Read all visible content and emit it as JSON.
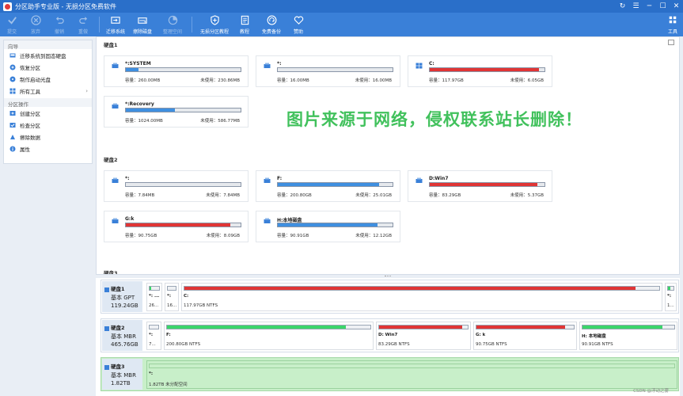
{
  "window": {
    "title": "分区助手专业版 - 无损分区免费软件",
    "controls": [
      "↻",
      "☰",
      "─",
      "☐",
      "✕"
    ]
  },
  "colors": {
    "titlebar": "#2a6fc9",
    "toolbar": "#3a80d8",
    "bar_blue": "#3f8fe0",
    "bar_red": "#e03535",
    "bar_green": "#3bd56a",
    "unallocated": "#c8efc9",
    "watermark": "#41c15c"
  },
  "toolbar": {
    "items": [
      {
        "label": "提交",
        "icon": "check-icon",
        "enabled": false
      },
      {
        "label": "放弃",
        "icon": "cancel-icon",
        "enabled": false
      },
      {
        "label": "撤销",
        "icon": "undo-icon",
        "enabled": false
      },
      {
        "label": "重做",
        "icon": "redo-icon",
        "enabled": false
      },
      {
        "label": "迁移系统",
        "icon": "migrate-os-icon",
        "enabled": true
      },
      {
        "label": "擦除磁盘",
        "icon": "wipe-disk-icon",
        "enabled": true
      },
      {
        "label": "整理空间",
        "icon": "allocate-space-icon",
        "enabled": false
      },
      {
        "label": "无损分区教程",
        "icon": "shield-icon",
        "enabled": true
      },
      {
        "label": "教程",
        "icon": "book-icon",
        "enabled": true
      },
      {
        "label": "免费备份",
        "icon": "backup-icon",
        "enabled": true
      },
      {
        "label": "赞助",
        "icon": "heart-icon",
        "enabled": true
      }
    ],
    "tools_label": "工具"
  },
  "sidebar": {
    "wizard_header": "向导",
    "wizard_items": [
      {
        "label": "迁移系统到固态硬盘",
        "icon": "migrate-icon"
      },
      {
        "label": "恢复分区",
        "icon": "recover-icon"
      },
      {
        "label": "制作启动光盘",
        "icon": "boot-disc-icon"
      },
      {
        "label": "所有工具",
        "icon": "tools-icon",
        "arrow": "›"
      }
    ],
    "ops_header": "分区操作",
    "ops_items": [
      {
        "label": "创建分区",
        "icon": "create-icon"
      },
      {
        "label": "检查分区",
        "icon": "check-partition-icon"
      },
      {
        "label": "擦除数据",
        "icon": "wipe-data-icon"
      },
      {
        "label": "属性",
        "icon": "info-icon"
      }
    ]
  },
  "main": {
    "disk1_title": "硬盘1",
    "disk2_title": "硬盘2",
    "disk3_title": "硬盘3",
    "cap_prefix": "容量：",
    "free_prefix": "未使用：",
    "disk1_cards": [
      {
        "name": "*:SYSTEM",
        "capacity": "260.00MB",
        "free": "230.86MB",
        "used_fraction": 0.11,
        "color": "blue",
        "icon": "drive-icon"
      },
      {
        "name": "*:",
        "capacity": "16.00MB",
        "free": "16.00MB",
        "used_fraction": 0.0,
        "color": "blue",
        "icon": "drive-icon"
      },
      {
        "name": "C:",
        "capacity": "117.97GB",
        "free": "6.05GB",
        "used_fraction": 0.95,
        "color": "red",
        "icon": "windows-icon"
      },
      {
        "name": "*:Recovery",
        "capacity": "1024.00MB",
        "free": "586.77MB",
        "used_fraction": 0.43,
        "color": "blue",
        "icon": "drive-icon"
      }
    ],
    "disk2_cards": [
      {
        "name": "*:",
        "capacity": "7.84MB",
        "free": "7.84MB",
        "used_fraction": 0.0,
        "color": "blue",
        "icon": "drive-icon"
      },
      {
        "name": "F:",
        "capacity": "200.80GB",
        "free": "25.01GB",
        "used_fraction": 0.88,
        "color": "blue",
        "icon": "drive-icon"
      },
      {
        "name": "D:Win7",
        "capacity": "83.29GB",
        "free": "5.37GB",
        "used_fraction": 0.94,
        "color": "red",
        "icon": "drive-icon"
      },
      {
        "name": "G:k",
        "capacity": "90.75GB",
        "free": "8.09GB",
        "used_fraction": 0.91,
        "color": "red",
        "icon": "drive-icon"
      },
      {
        "name": "H:本地磁盘",
        "capacity": "90.91GB",
        "free": "12.12GB",
        "used_fraction": 0.87,
        "color": "blue",
        "icon": "drive-icon"
      }
    ],
    "watermark": "图片来源于网络，侵权联系站长删除！"
  },
  "diskmap": {
    "rows": [
      {
        "name": "硬盘1",
        "type": "基本 GPT",
        "size": "119.24GB",
        "segments": [
          {
            "name": "*: ...",
            "size": "26...",
            "used_fraction": 0.15,
            "color": "green"
          },
          {
            "name": "*:",
            "size": "16...",
            "used_fraction": 0.0,
            "color": "green"
          },
          {
            "name": "C:",
            "size": "117.97GB NTFS",
            "used_fraction": 0.95,
            "color": "red"
          },
          {
            "name": "*:",
            "size": "1...",
            "used_fraction": 0.45,
            "color": "green"
          }
        ]
      },
      {
        "name": "硬盘2",
        "type": "基本 MBR",
        "size": "465.76GB",
        "segments": [
          {
            "name": "*:",
            "size": "7...",
            "used_fraction": 0.0,
            "color": "green"
          },
          {
            "name": "F:",
            "size": "200.80GB NTFS",
            "used_fraction": 0.88,
            "color": "green"
          },
          {
            "name": "D: Win7",
            "size": "83.29GB NTFS",
            "used_fraction": 0.94,
            "color": "red"
          },
          {
            "name": "G: k",
            "size": "90.75GB NTFS",
            "used_fraction": 0.91,
            "color": "red"
          },
          {
            "name": "H: 本地磁盘",
            "size": "90.91GB NTFS",
            "used_fraction": 0.87,
            "color": "green"
          }
        ]
      },
      {
        "name": "硬盘3",
        "type": "基本 MBR",
        "size": "1.82TB",
        "segments": [
          {
            "name": "*:",
            "size": "1.82TB 未分配空间",
            "used_fraction": 0.0,
            "color": "unalloc"
          }
        ]
      }
    ]
  },
  "watermark_credit": "CSDN @浮动之雾"
}
